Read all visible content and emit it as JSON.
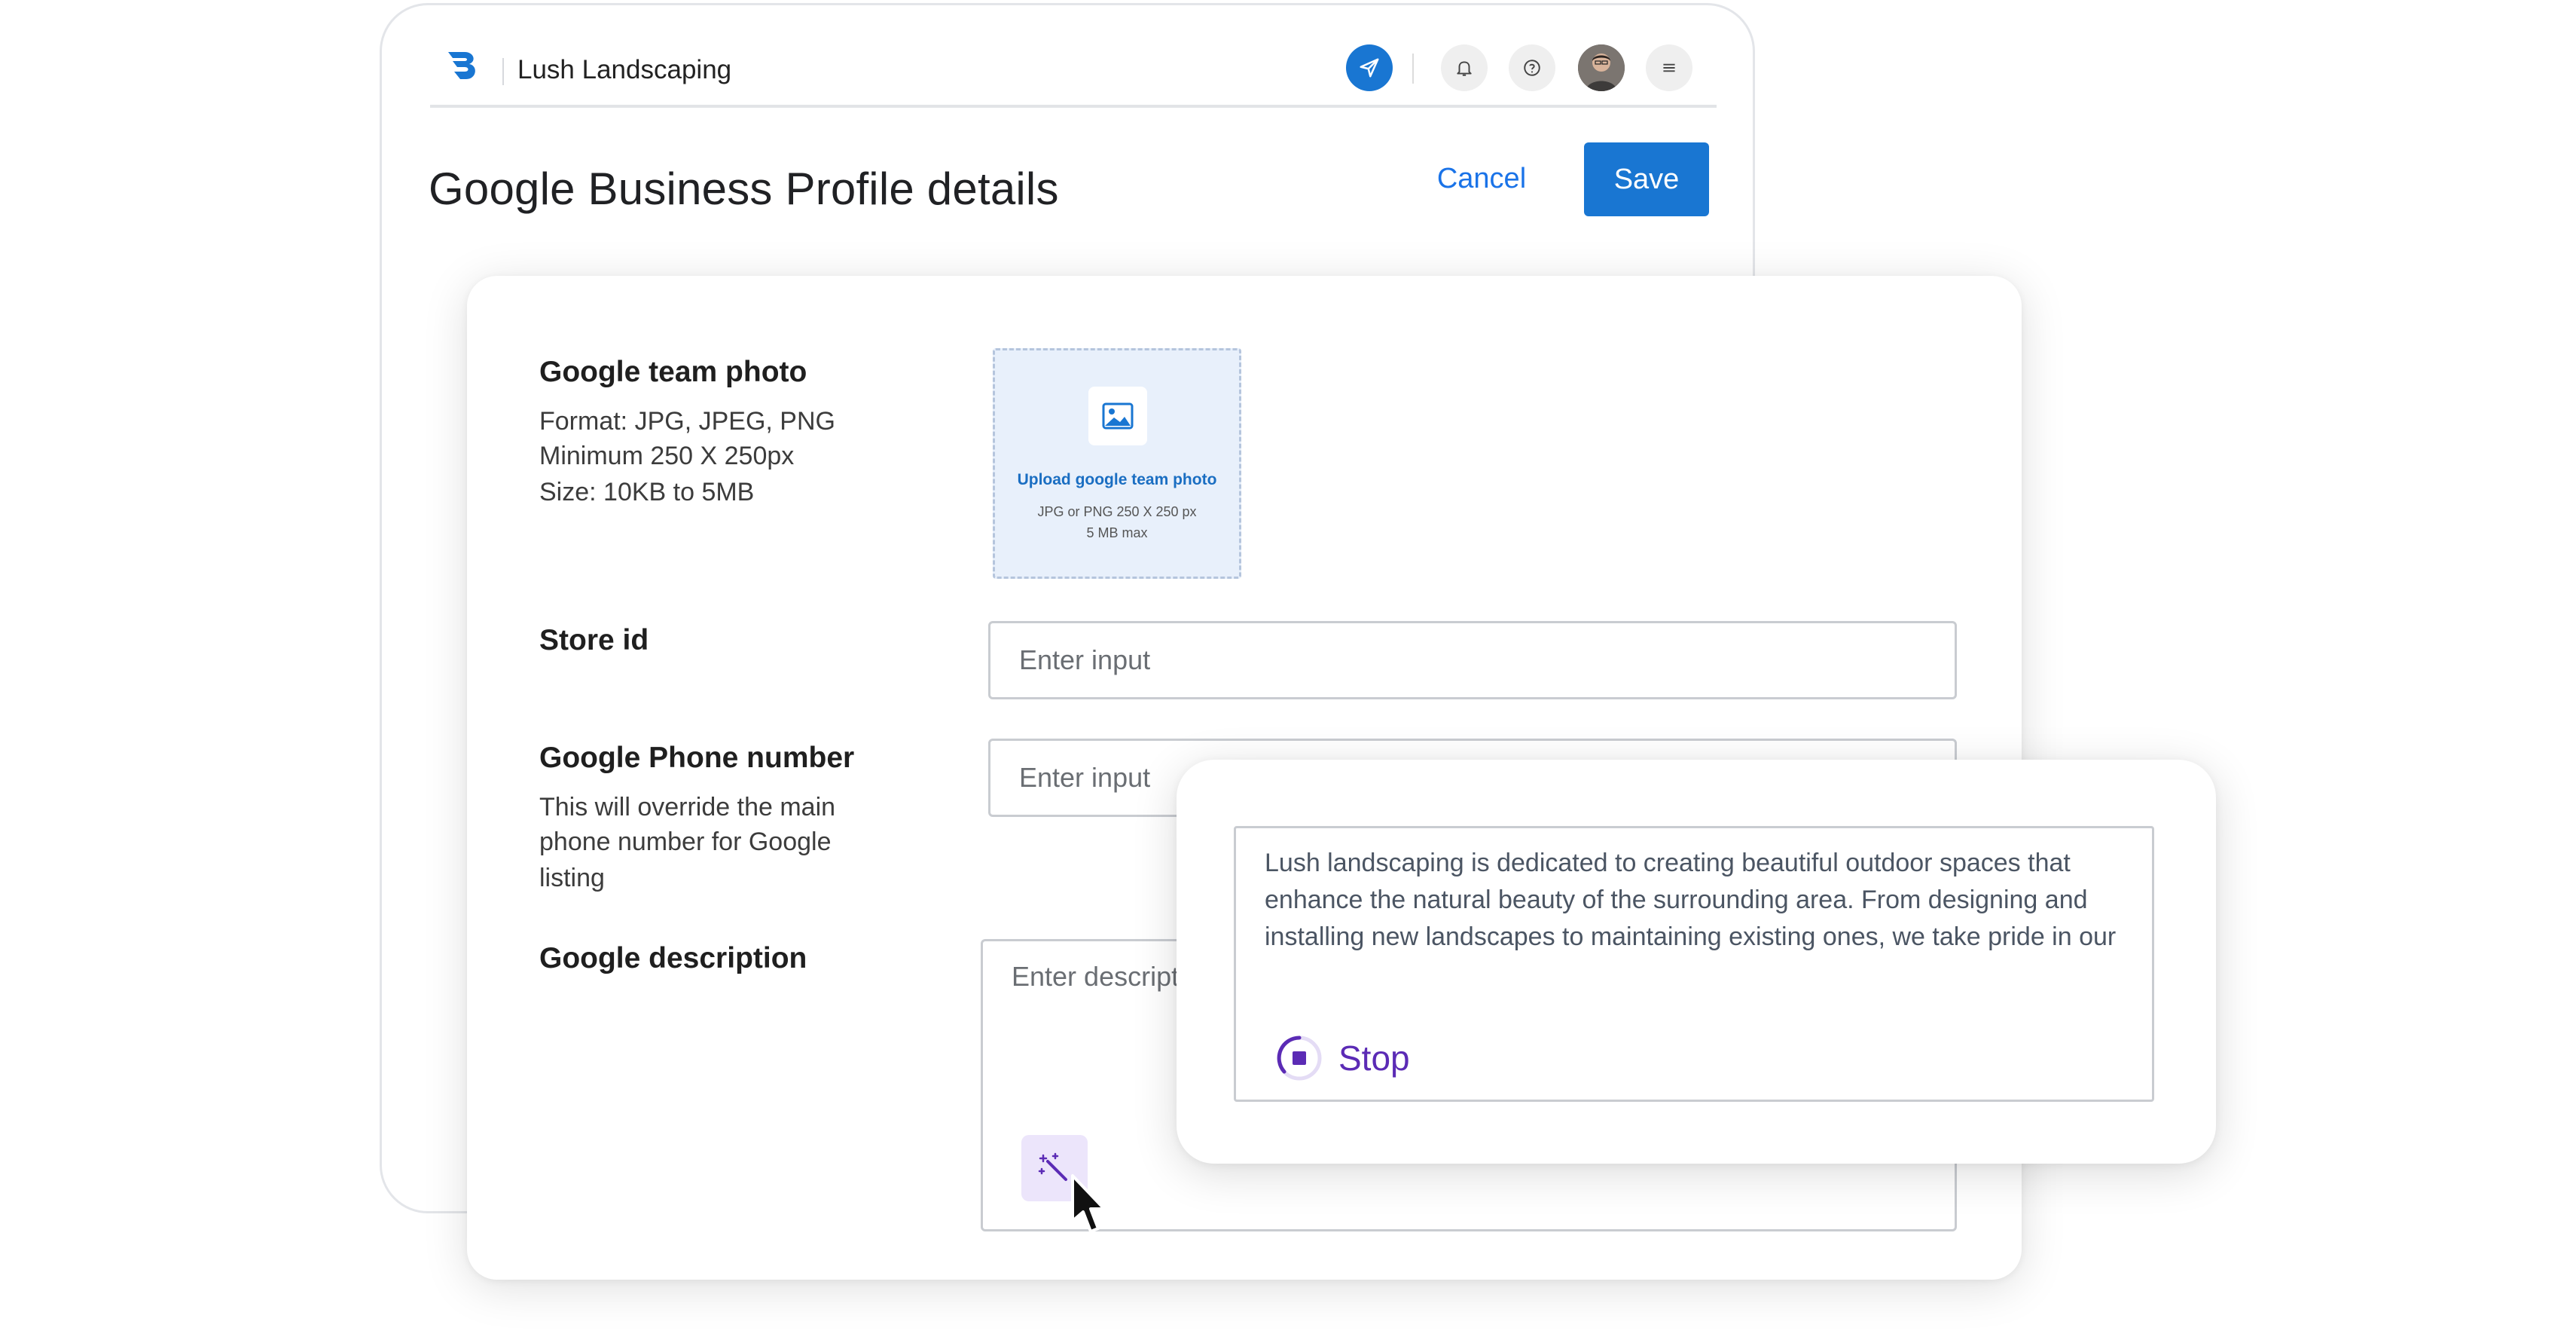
{
  "header": {
    "app_name": "Lush Landscaping",
    "icons": [
      "send-icon",
      "bell-icon",
      "help-icon",
      "avatar",
      "menu-icon"
    ]
  },
  "page": {
    "title": "Google Business Profile details",
    "cancel_label": "Cancel",
    "save_label": "Save"
  },
  "form": {
    "team_photo": {
      "label": "Google team photo",
      "help": [
        "Format: JPG, JPEG, PNG",
        "Minimum 250 X 250px",
        "Size: 10KB to 5MB"
      ],
      "upload_title": "Upload google team photo",
      "upload_sub1": "JPG or PNG 250 X 250 px",
      "upload_sub2": "5 MB max"
    },
    "store_id": {
      "label": "Store id",
      "placeholder": "Enter input",
      "value": ""
    },
    "phone": {
      "label": "Google Phone number",
      "help": [
        "This will override the main",
        "phone number for Google",
        "listing"
      ],
      "placeholder": "Enter input",
      "value": ""
    },
    "description": {
      "label": "Google description",
      "placeholder": "Enter description",
      "value": ""
    }
  },
  "ai_popup": {
    "generated_text": "Lush landscaping is dedicated to creating beautiful outdoor spaces that enhance the natural beauty of the surrounding area. From designing and installing new landscapes to maintaining existing ones, we take pride in our",
    "stop_label": "Stop"
  },
  "colors": {
    "primary": "#1976d2",
    "link": "#1a73e8",
    "ai_purple": "#5b2bb5",
    "ai_bg": "#ece5fb"
  }
}
